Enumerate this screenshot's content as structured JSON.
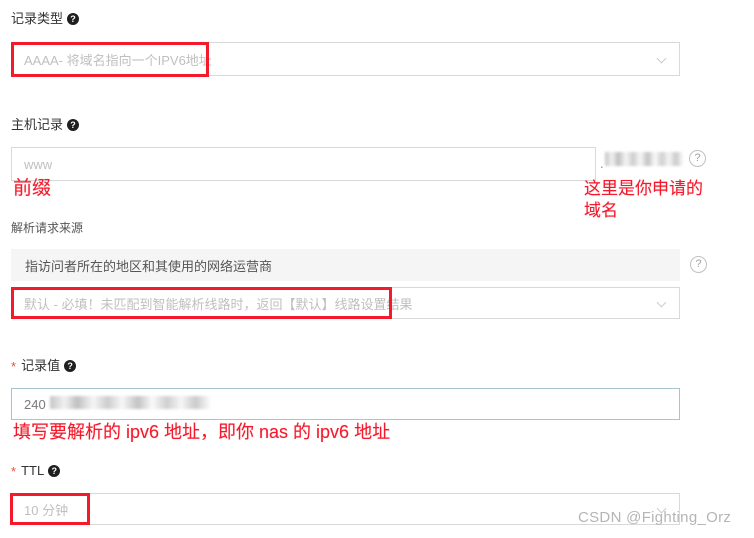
{
  "form": {
    "record_type": {
      "label": "记录类型",
      "help_icon": "help-icon",
      "value": "AAAA- 将域名指向一个IPV6地址",
      "chevron_icon": "chevron-down-icon"
    },
    "host_record": {
      "label": "主机记录",
      "help_icon": "help-icon",
      "placeholder": "www",
      "domain_suffix_redacted": "redacted-domain",
      "suffix_help_icon": "help-circle-icon"
    },
    "request_source": {
      "label": "解析请求来源",
      "info_text": "指访问者所在的地区和其使用的网络运营商",
      "info_help_icon": "help-circle-icon",
      "value": "默认 - 必填！未匹配到智能解析线路时，返回【默认】线路设置结果",
      "chevron_icon": "chevron-down-icon"
    },
    "record_value": {
      "required_marker": "*",
      "label": "记录值",
      "help_icon": "help-icon",
      "value_prefix": "240",
      "value_redacted": "redacted-ipv6-address"
    },
    "ttl": {
      "required_marker": "*",
      "label": "TTL",
      "help_icon": "help-icon",
      "value": "10 分钟",
      "chevron_icon": "chevron-down-icon"
    }
  },
  "annotations": {
    "prefix_note": "前缀",
    "domain_note": "这里是你申请的\n域名",
    "ipv6_note": "填写要解析的 ipv6 地址，即你 nas 的 ipv6 地址"
  },
  "watermark": {
    "text": "CSDN @Fighting_Orz"
  },
  "colors": {
    "annotation_red": "#f4192b",
    "required_red": "#e8513d",
    "border_gray": "#d9d9d9",
    "info_bg": "#f5f5f5",
    "focus_border": "#a8c4d0"
  }
}
